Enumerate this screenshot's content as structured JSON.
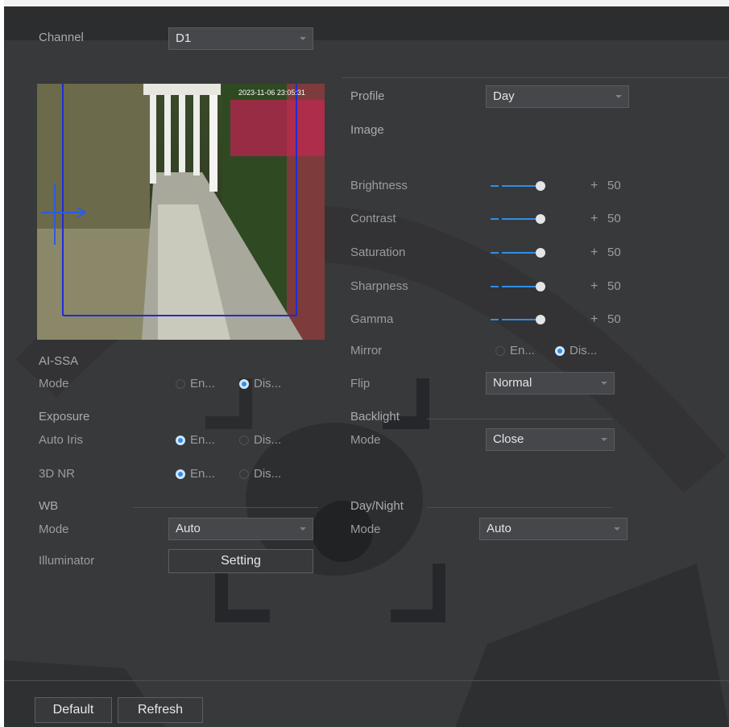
{
  "channel": {
    "label": "Channel",
    "value": "D1"
  },
  "preview": {
    "timestamp": "2023-11-06 23:05:31"
  },
  "profile": {
    "label": "Profile",
    "value": "Day"
  },
  "image": {
    "label": "Image",
    "sliders": [
      {
        "label": "Brightness",
        "minus": "−",
        "plus": "+",
        "value": "50",
        "level": 50
      },
      {
        "label": "Contrast",
        "minus": "−",
        "plus": "+",
        "value": "50",
        "level": 50
      },
      {
        "label": "Saturation",
        "minus": "−",
        "plus": "+",
        "value": "50",
        "level": 50
      },
      {
        "label": "Sharpness",
        "minus": "−",
        "plus": "+",
        "value": "50",
        "level": 50
      },
      {
        "label": "Gamma",
        "minus": "−",
        "plus": "+",
        "value": "50",
        "level": 50
      }
    ]
  },
  "mirror": {
    "label": "Mirror",
    "enable": "En...",
    "disable": "Dis...",
    "selected": "disable"
  },
  "flip": {
    "label": "Flip",
    "value": "Normal"
  },
  "backlight": {
    "label": "Backlight",
    "mode_label": "Mode",
    "mode_value": "Close"
  },
  "ai_ssa": {
    "label": "AI-SSA",
    "mode_label": "Mode",
    "enable": "En...",
    "disable": "Dis...",
    "selected": "disable"
  },
  "exposure": {
    "label": "Exposure",
    "auto_iris_label": "Auto Iris",
    "enable": "En...",
    "disable": "Dis...",
    "selected": "enable"
  },
  "nr3d": {
    "label": "3D NR",
    "enable": "En...",
    "disable": "Dis...",
    "selected": "enable"
  },
  "wb": {
    "label": "WB",
    "mode_label": "Mode",
    "mode_value": "Auto"
  },
  "illuminator": {
    "label": "Illuminator",
    "button": "Setting"
  },
  "day_night": {
    "label": "Day/Night",
    "mode_label": "Mode",
    "mode_value": "Auto"
  },
  "footer": {
    "default_button": "Default",
    "refresh_button": "Refresh"
  },
  "colors": {
    "accent": "#2f8ee8",
    "background": "#38393b",
    "panel_dark": "#2c2d2f"
  }
}
